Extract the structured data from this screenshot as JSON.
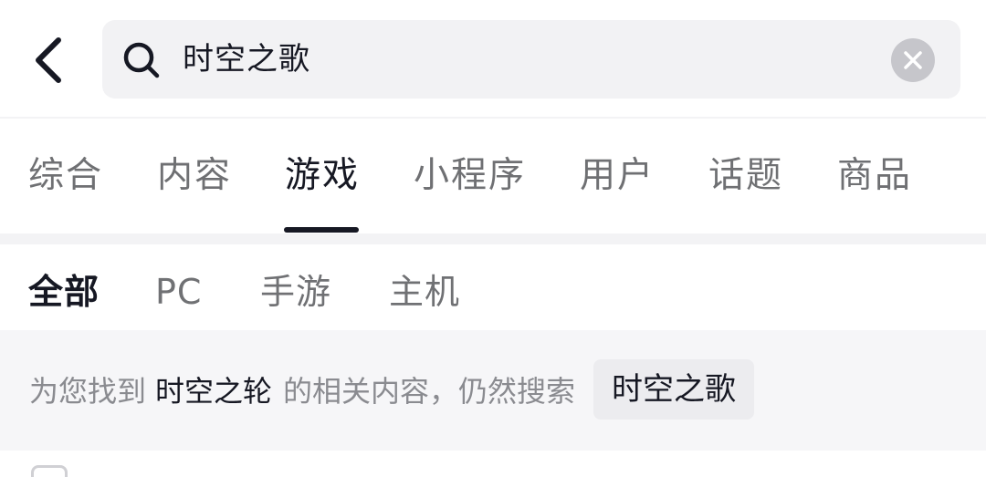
{
  "search": {
    "query": "时空之歌"
  },
  "tabs": [
    {
      "label": "综合",
      "active": false
    },
    {
      "label": "内容",
      "active": false
    },
    {
      "label": "游戏",
      "active": true
    },
    {
      "label": "小程序",
      "active": false
    },
    {
      "label": "用户",
      "active": false
    },
    {
      "label": "话题",
      "active": false
    },
    {
      "label": "商品",
      "active": false
    }
  ],
  "subtabs": [
    {
      "label": "全部",
      "active": true
    },
    {
      "label": "PC",
      "active": false
    },
    {
      "label": "手游",
      "active": false
    },
    {
      "label": "主机",
      "active": false
    }
  ],
  "notice": {
    "prefix": "为您找到",
    "corrected_term": "时空之轮",
    "suffix": "的相关内容，仍然搜索",
    "original_term": "时空之歌"
  },
  "icons": {
    "back": "chevron-left-icon",
    "search": "search-icon",
    "clear": "clear-icon"
  },
  "colors": {
    "text_primary": "#161823",
    "text_secondary": "#6f7073",
    "search_bg": "#f2f2f4",
    "notice_bg": "#f6f6f8"
  }
}
